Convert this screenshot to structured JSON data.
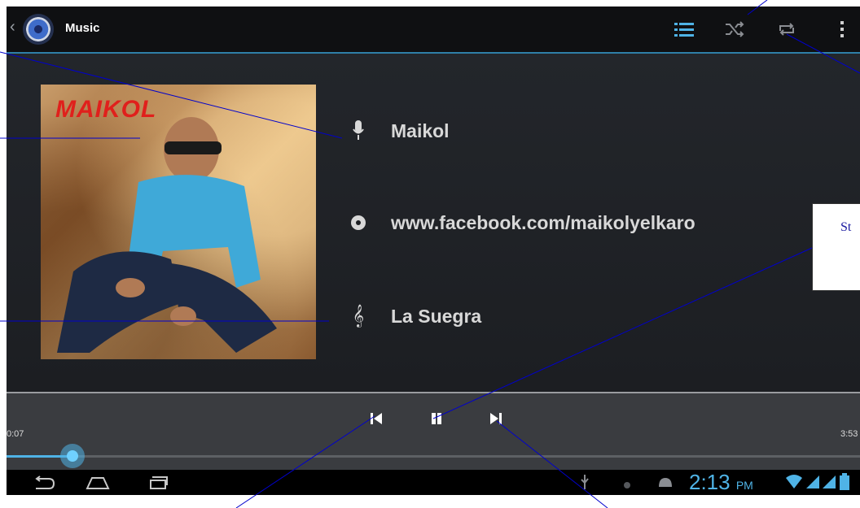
{
  "action_bar": {
    "title": "Music",
    "icons": [
      "music-app-icon",
      "playlist-icon",
      "shuffle-icon",
      "repeat-icon",
      "overflow-menu-icon"
    ]
  },
  "track": {
    "artist": "Maikol",
    "album": "www.facebook.com/maikolyelkaro",
    "song": "La Suegra",
    "album_art_text": "MAIKOL"
  },
  "player": {
    "elapsed": "0:07",
    "duration": "3:53",
    "progress_fraction": 0.03
  },
  "system_bar": {
    "time": "2:13",
    "ampm": "PM"
  },
  "annotation": {
    "callout_text": "St"
  },
  "colors": {
    "accent": "#4fb3e6",
    "background": "#1c1e22",
    "callout_line": "#0000cc",
    "album_art_text": "#e0201c"
  }
}
